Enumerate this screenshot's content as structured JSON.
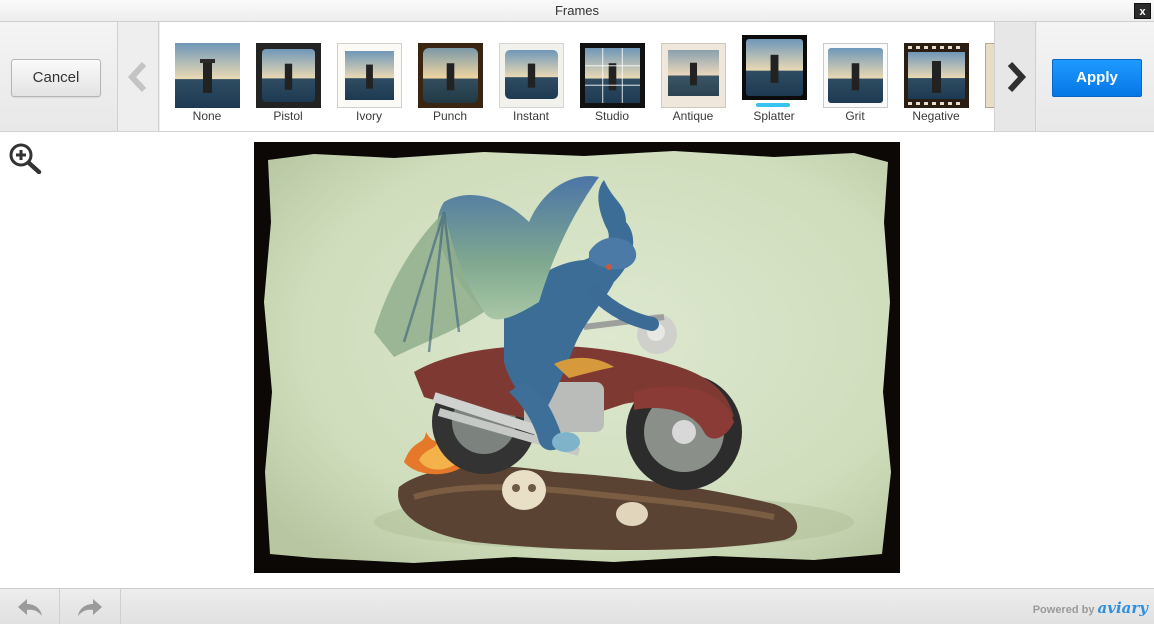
{
  "window": {
    "title": "Frames",
    "close_label": "x"
  },
  "toolbar": {
    "cancel_label": "Cancel",
    "apply_label": "Apply"
  },
  "frames": {
    "items": [
      {
        "label": "None"
      },
      {
        "label": "Pistol"
      },
      {
        "label": "Ivory"
      },
      {
        "label": "Punch"
      },
      {
        "label": "Instant"
      },
      {
        "label": "Studio"
      },
      {
        "label": "Antique"
      },
      {
        "label": "Splatter",
        "selected": true
      },
      {
        "label": "Grit"
      },
      {
        "label": "Negative"
      }
    ]
  },
  "footer": {
    "powered_label": "Powered by",
    "brand_label": "aviary"
  },
  "colors": {
    "accent": "#0a84f0",
    "selection": "#39c2f0",
    "brand": "#2d8fe0"
  },
  "icons": {
    "close": "close-icon",
    "prev": "chevron-left-icon",
    "next": "chevron-right-icon",
    "zoom": "zoom-in-icon",
    "undo": "undo-icon",
    "redo": "redo-icon"
  }
}
